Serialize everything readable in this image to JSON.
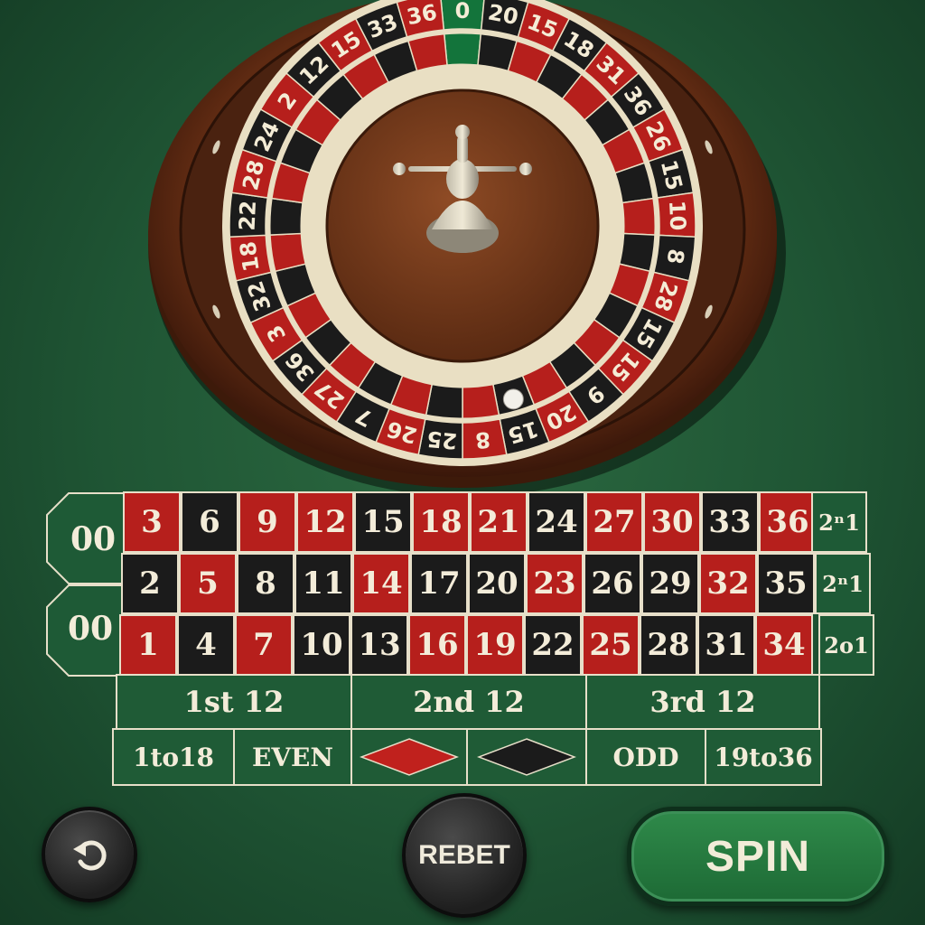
{
  "colors": {
    "felt": "#1f5534",
    "red": "#b61f1c",
    "black": "#1b1b1b",
    "green": "#1e5a36",
    "line": "#e7dfc9",
    "wood": "#6b3317"
  },
  "wheel": {
    "pockets": [
      "0",
      "20",
      "15",
      "18",
      "31",
      "36",
      "26",
      "15",
      "10",
      "8",
      "28",
      "15",
      "15",
      "9",
      "20",
      "15",
      "8",
      "25",
      "26",
      "7",
      "27",
      "36",
      "3",
      "32",
      "18",
      "22",
      "28",
      "24",
      "2",
      "12",
      "15",
      "33",
      "36"
    ],
    "pocket_colors": [
      "green",
      "black",
      "red",
      "black",
      "red",
      "black",
      "red",
      "black",
      "red",
      "black",
      "red",
      "black",
      "red",
      "black",
      "red",
      "black",
      "red",
      "black",
      "red",
      "black",
      "red",
      "black",
      "red",
      "black",
      "red",
      "black",
      "red",
      "black",
      "red",
      "black",
      "red",
      "black",
      "red"
    ],
    "ball_pocket_index": 15
  },
  "table": {
    "zeros": [
      "00",
      "00"
    ],
    "rows": [
      {
        "numbers": [
          "3",
          "6",
          "9",
          "12",
          "15",
          "18",
          "21",
          "24",
          "27",
          "30",
          "33",
          "36"
        ],
        "colors": [
          "red",
          "black",
          "red",
          "red",
          "black",
          "red",
          "red",
          "black",
          "red",
          "red",
          "black",
          "red"
        ],
        "column_bet": "2ⁿ1"
      },
      {
        "numbers": [
          "2",
          "5",
          "8",
          "11",
          "14",
          "17",
          "20",
          "23",
          "26",
          "29",
          "32",
          "35"
        ],
        "colors": [
          "black",
          "red",
          "black",
          "black",
          "red",
          "black",
          "black",
          "red",
          "black",
          "black",
          "red",
          "black"
        ],
        "column_bet": "2ⁿ1"
      },
      {
        "numbers": [
          "1",
          "4",
          "7",
          "10",
          "13",
          "16",
          "19",
          "22",
          "25",
          "28",
          "31",
          "34"
        ],
        "colors": [
          "red",
          "black",
          "red",
          "black",
          "black",
          "red",
          "red",
          "black",
          "red",
          "black",
          "black",
          "red"
        ],
        "column_bet": "2o1"
      }
    ],
    "dozens": [
      "1st 12",
      "2nd 12",
      "3rd 12"
    ],
    "outside": {
      "low": "1to18",
      "even": "EVEN",
      "red_icon": "red-diamond-icon",
      "black_icon": "black-diamond-icon",
      "odd": "ODD",
      "high": "19to36"
    }
  },
  "controls": {
    "undo_icon": "undo-icon",
    "rebet_label": "REBET",
    "spin_label": "SPIN"
  }
}
